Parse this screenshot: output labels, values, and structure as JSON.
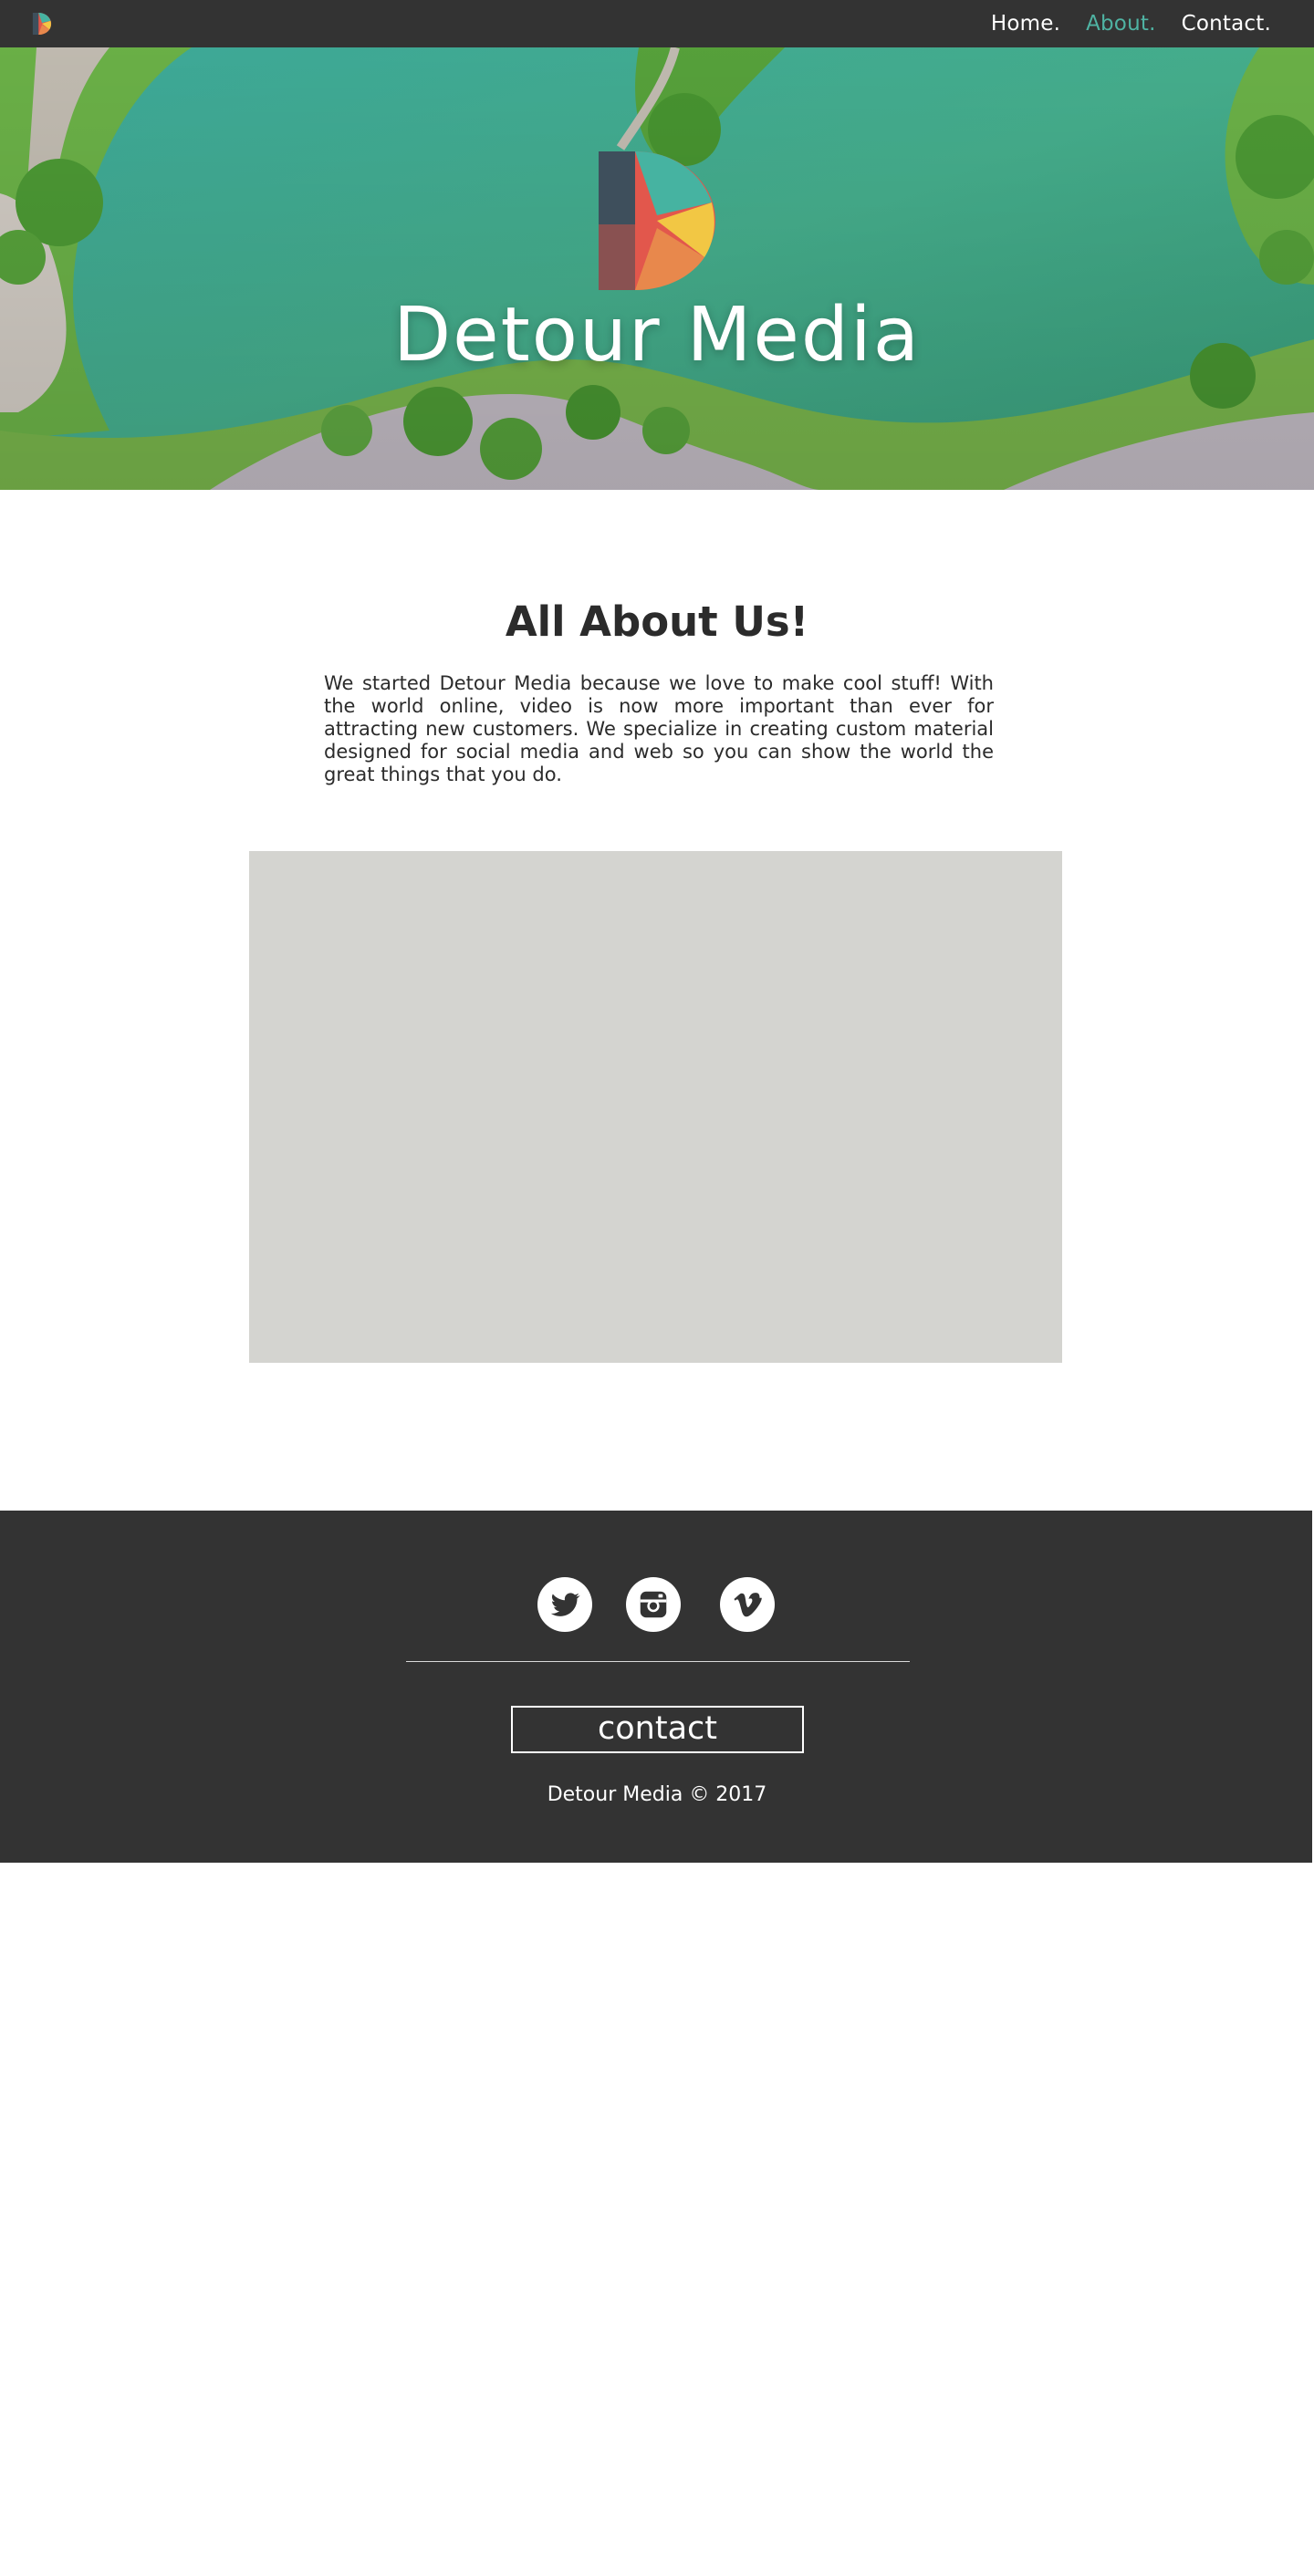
{
  "nav": {
    "logo_icon": "detour-media-logo-icon",
    "links": [
      {
        "label": "Home.",
        "active": false
      },
      {
        "label": "About.",
        "active": true
      },
      {
        "label": "Contact.",
        "active": false
      }
    ],
    "active_color": "#4fb3a3"
  },
  "hero": {
    "title": "Detour Media",
    "logo_icon": "detour-media-logo-icon"
  },
  "about": {
    "heading": "All About Us!",
    "body": "We started Detour Media because we love to make cool stuff! With the world online, video is now more important than ever for attracting new customers. We specialize in creating custom material designed for social media and web so you can show the world the great things that you do."
  },
  "footer": {
    "social": [
      {
        "icon": "twitter-icon"
      },
      {
        "icon": "instagram-icon"
      },
      {
        "icon": "vimeo-icon"
      }
    ],
    "contact_label": "contact",
    "copyright": "Detour Media © 2017"
  },
  "colors": {
    "nav_bg": "#333333",
    "footer_bg": "#333333",
    "accent": "#4fb3a3",
    "video_placeholder": "#d4d4d0"
  }
}
